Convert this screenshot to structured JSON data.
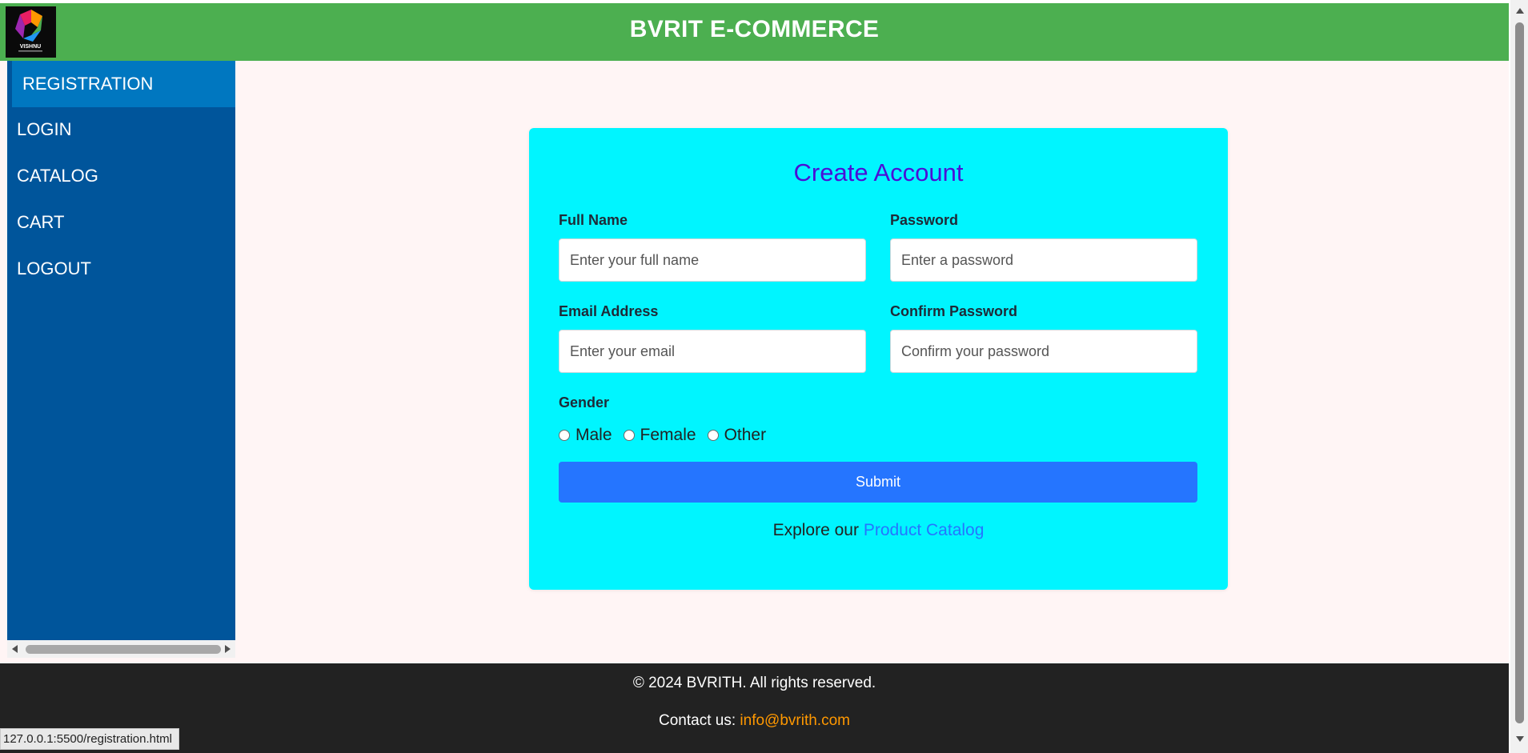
{
  "header": {
    "title": "BVRIT E-COMMERCE",
    "logo_text": "VISHNU"
  },
  "sidebar": {
    "items": [
      {
        "label": "REGISTRATION",
        "active": true
      },
      {
        "label": "LOGIN"
      },
      {
        "label": "CATALOG"
      },
      {
        "label": "CART"
      },
      {
        "label": "LOGOUT"
      }
    ]
  },
  "form": {
    "title": "Create Account",
    "full_name": {
      "label": "Full Name",
      "placeholder": "Enter your full name",
      "value": ""
    },
    "password": {
      "label": "Password",
      "placeholder": "Enter a password",
      "value": ""
    },
    "email": {
      "label": "Email Address",
      "placeholder": "Enter your email",
      "value": ""
    },
    "confirm_password": {
      "label": "Confirm Password",
      "placeholder": "Confirm your password",
      "value": ""
    },
    "gender": {
      "label": "Gender",
      "options": [
        "Male",
        "Female",
        "Other"
      ],
      "selected": null
    },
    "submit_label": "Submit",
    "explore_text": "Explore our",
    "explore_link": "Product Catalog"
  },
  "footer": {
    "copyright": "© 2024 BVRITH. All rights reserved.",
    "contact_prefix": "Contact us:",
    "contact_email": "info@bvrith.com"
  },
  "status_bar": {
    "url": "127.0.0.1:5500/registration.html"
  },
  "colors": {
    "header_bg": "#4caf50",
    "sidebar_bg": "#00559b",
    "sidebar_active": "#0077c0",
    "card_bg": "#00f5ff",
    "title_color": "#4b0fd6",
    "submit_bg": "#2575ff",
    "link_color": "#2575ff",
    "footer_bg": "#222222",
    "email_color": "#ff9800"
  }
}
